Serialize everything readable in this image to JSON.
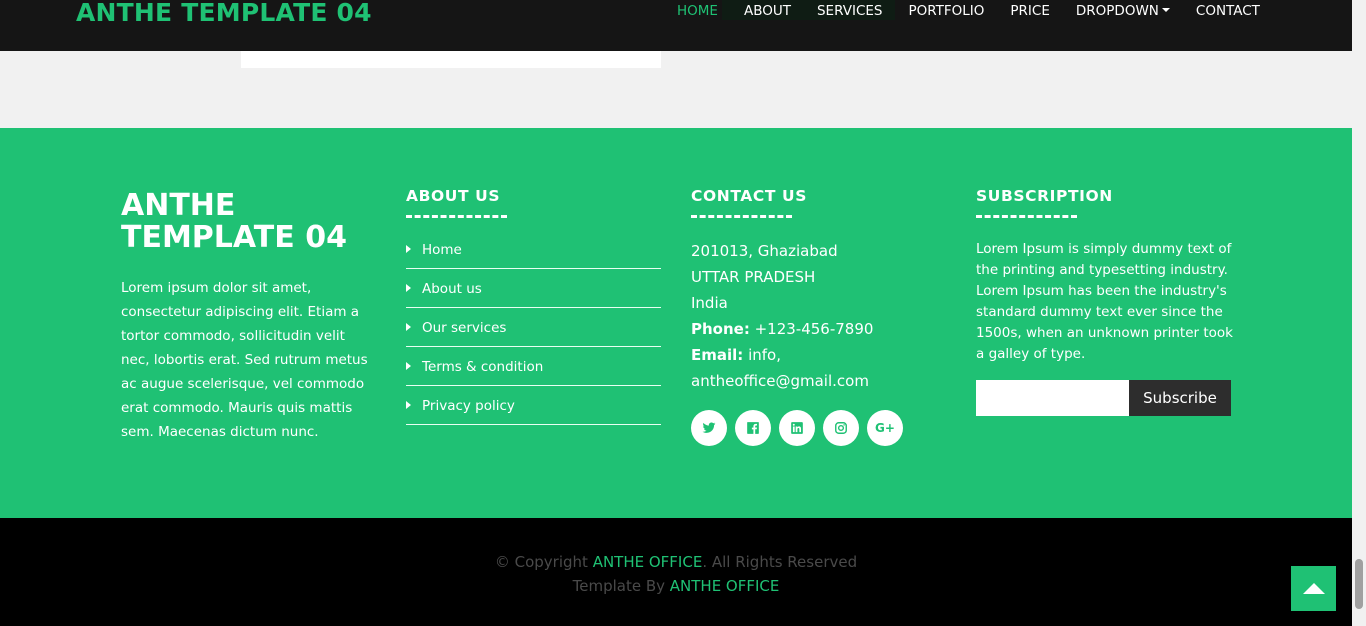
{
  "header": {
    "brand": "ANTHE TEMPLATE 04",
    "menu": [
      "HOME",
      "ABOUT",
      "SERVICES",
      "PORTFOLIO",
      "PRICE",
      "DROPDOWN",
      "CONTACT"
    ]
  },
  "footer": {
    "brand": "ANTHE TEMPLATE 04",
    "about_text": "Lorem ipsum dolor sit amet, consectetur adipiscing elit. Etiam a tortor commodo, sollicitudin velit nec, lobortis erat. Sed rutrum metus ac augue scelerisque, vel commodo erat commodo. Mauris quis mattis sem. Maecenas dictum nunc.",
    "about_us": {
      "heading": "ABOUT US",
      "links": [
        "Home",
        "About us",
        "Our services",
        "Terms & condition",
        "Privacy policy"
      ]
    },
    "contact_us": {
      "heading": "CONTACT US",
      "address1": "201013, Ghaziabad",
      "address2": "UTTAR PRADESH",
      "address3": "India",
      "phone_label": "Phone:",
      "phone": "+123-456-7890",
      "email_label": "Email:",
      "email_part1": "info,",
      "email_part2": "antheoffice@gmail.com",
      "socials": [
        "twitter-icon",
        "facebook-icon",
        "linkedin-icon",
        "instagram-icon",
        "google-plus-icon"
      ],
      "gplus_text": "G+"
    },
    "subscription": {
      "heading": "SUBSCRIPTION",
      "text": "Lorem Ipsum is simply dummy text of the printing and typesetting industry. Lorem Ipsum has been the industry's standard dummy text ever since the 1500s, when an unknown printer took a galley of type.",
      "input_placeholder": "",
      "button": "Subscribe"
    }
  },
  "bottom": {
    "copy_prefix": "© Copyright ",
    "copy_brand": "ANTHE OFFICE",
    "copy_suffix": ". All Rights Reserved",
    "template_prefix": "Template By ",
    "template_brand": "ANTHE OFFICE"
  },
  "colors": {
    "accent": "#1fc174",
    "nav_bg": "#151515",
    "bottom_bg": "#000000"
  }
}
